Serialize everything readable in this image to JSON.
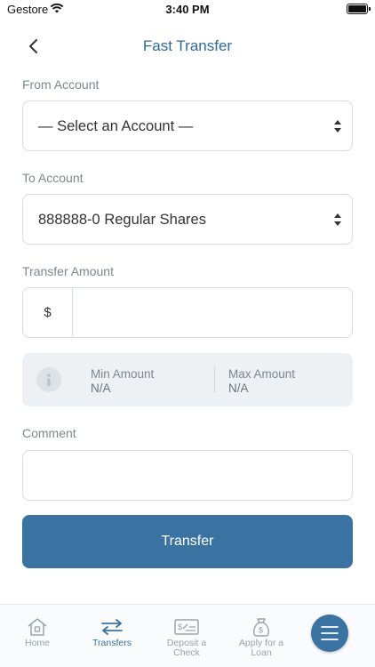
{
  "status_bar": {
    "carrier": "Gestore",
    "time": "3:40 PM"
  },
  "header": {
    "title": "Fast Transfer"
  },
  "form": {
    "from_label": "From Account",
    "from_value": "— Select an Account —",
    "to_label": "To Account",
    "to_value": "888888-0 Regular Shares",
    "amount_label": "Transfer Amount",
    "currency_symbol": "$",
    "amount_value": "",
    "limits": {
      "min_label": "Min Amount",
      "min_value": "N/A",
      "max_label": "Max Amount",
      "max_value": "N/A"
    },
    "comment_label": "Comment",
    "comment_value": "",
    "submit_label": "Transfer"
  },
  "tab_bar": {
    "tabs": [
      {
        "label": "Home",
        "icon": "home-icon",
        "active": false
      },
      {
        "label": "Transfers",
        "icon": "transfer-arrows-icon",
        "active": true
      },
      {
        "label": "Deposit a\nCheck",
        "icon": "check-deposit-icon",
        "active": false
      },
      {
        "label": "Apply for a\nLoan",
        "icon": "money-bag-icon",
        "active": false
      }
    ],
    "menu_icon": "hamburger-menu-icon"
  },
  "colors": {
    "accent": "#3a73a2",
    "title": "#2d6a9b",
    "label": "#7d8790",
    "border": "#d6dbe0",
    "limits_bg": "#eef1f4"
  }
}
